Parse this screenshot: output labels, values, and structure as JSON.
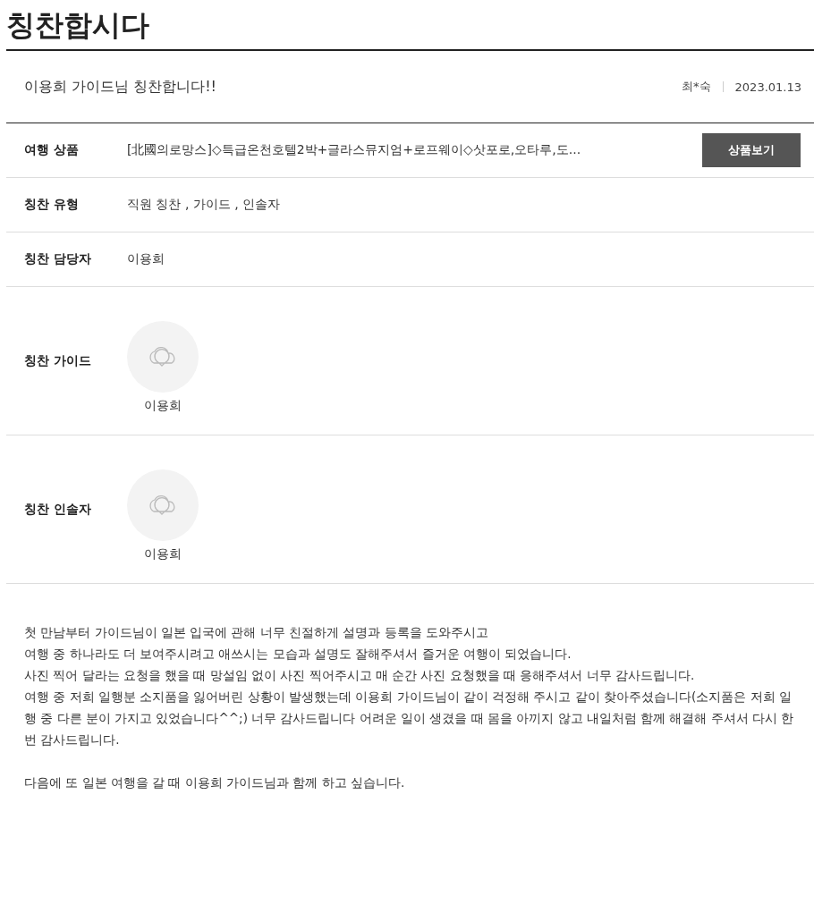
{
  "page_title": "칭찬합시다",
  "post": {
    "title": "이용희 가이드님 칭찬합니다!!",
    "author": "최*숙",
    "date": "2023.01.13"
  },
  "fields": [
    {
      "kind": "product",
      "label": "여행 상품",
      "value": "[北國의로망스]◇특급온천호텔2박+글라스뮤지엄+로프웨이◇삿포로,오타루,도...",
      "button": "상품보기"
    },
    {
      "kind": "text",
      "label": "칭찬 유형",
      "value": "직원 칭찬 , 가이드 , 인솔자"
    },
    {
      "kind": "text",
      "label": "칭찬 담당자",
      "value": "이용희"
    },
    {
      "kind": "person",
      "label": "칭찬 가이드",
      "value": "이용희"
    },
    {
      "kind": "person",
      "label": "칭찬 인솔자",
      "value": "이용희"
    }
  ],
  "body": [
    {
      "lines": [
        "첫 만남부터 가이드님이 일본 입국에 관해 너무 친절하게 설명과 등록을 도와주시고",
        "여행 중 하나라도 더 보여주시려고 애쓰시는 모습과 설명도 잘해주셔서 즐거운 여행이 되었습니다.",
        "사진 찍어 달라는 요청을 했을 때 망설임 없이 사진 찍어주시고 매 순간 사진 요청했을 때 응해주셔서 너무 감사드립니다.",
        "여행 중 저희 일행분 소지품을 잃어버린 상황이 발생했는데 이용희 가이드님이 같이 걱정해 주시고 같이 찾아주셨습니다(소지품은 저희 일행 중 다른 분이 가지고 있었습니다^^;) 너무 감사드립니다 어려운 일이 생겼을 때 몸을 아끼지 않고 내일처럼 함께 해결해 주셔서 다시 한번 감사드립니다."
      ]
    },
    {
      "lines": [
        "다음에 또 일본 여행을 갈 때 이용희 가이드님과 함께 하고 싶습니다."
      ]
    }
  ]
}
